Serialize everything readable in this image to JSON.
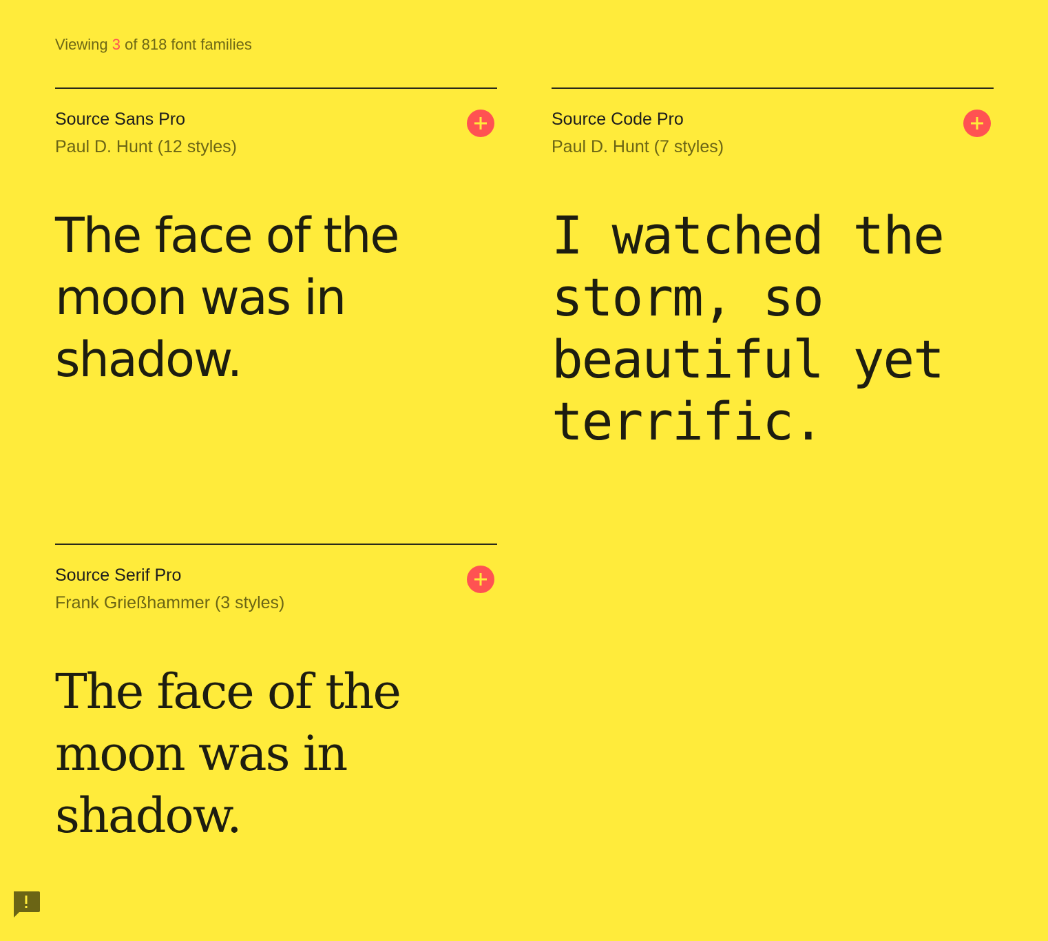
{
  "header": {
    "viewing_prefix": "Viewing",
    "viewing_count": "3",
    "viewing_suffix": "of 818 font families"
  },
  "cards": [
    {
      "family": "Source Sans Pro",
      "designer": "Paul D. Hunt (12 styles)",
      "sample": "The face of the moon was in shadow.",
      "add_icon": "plus-circle-icon"
    },
    {
      "family": "Source Code Pro",
      "designer": "Paul D. Hunt (7 styles)",
      "sample": "I watched the storm, so beautiful yet terrific.",
      "add_icon": "plus-circle-icon"
    },
    {
      "family": "Source Serif Pro",
      "designer": "Frank Grießhammer (3 styles)",
      "sample": "The face of the moon was in shadow.",
      "add_icon": "plus-circle-icon"
    }
  ],
  "feedback": {
    "icon": "feedback-icon"
  },
  "colors": {
    "background": "#ffeb3b",
    "accent": "#ff5252",
    "text": "#212121",
    "muted": "#6b6515"
  }
}
